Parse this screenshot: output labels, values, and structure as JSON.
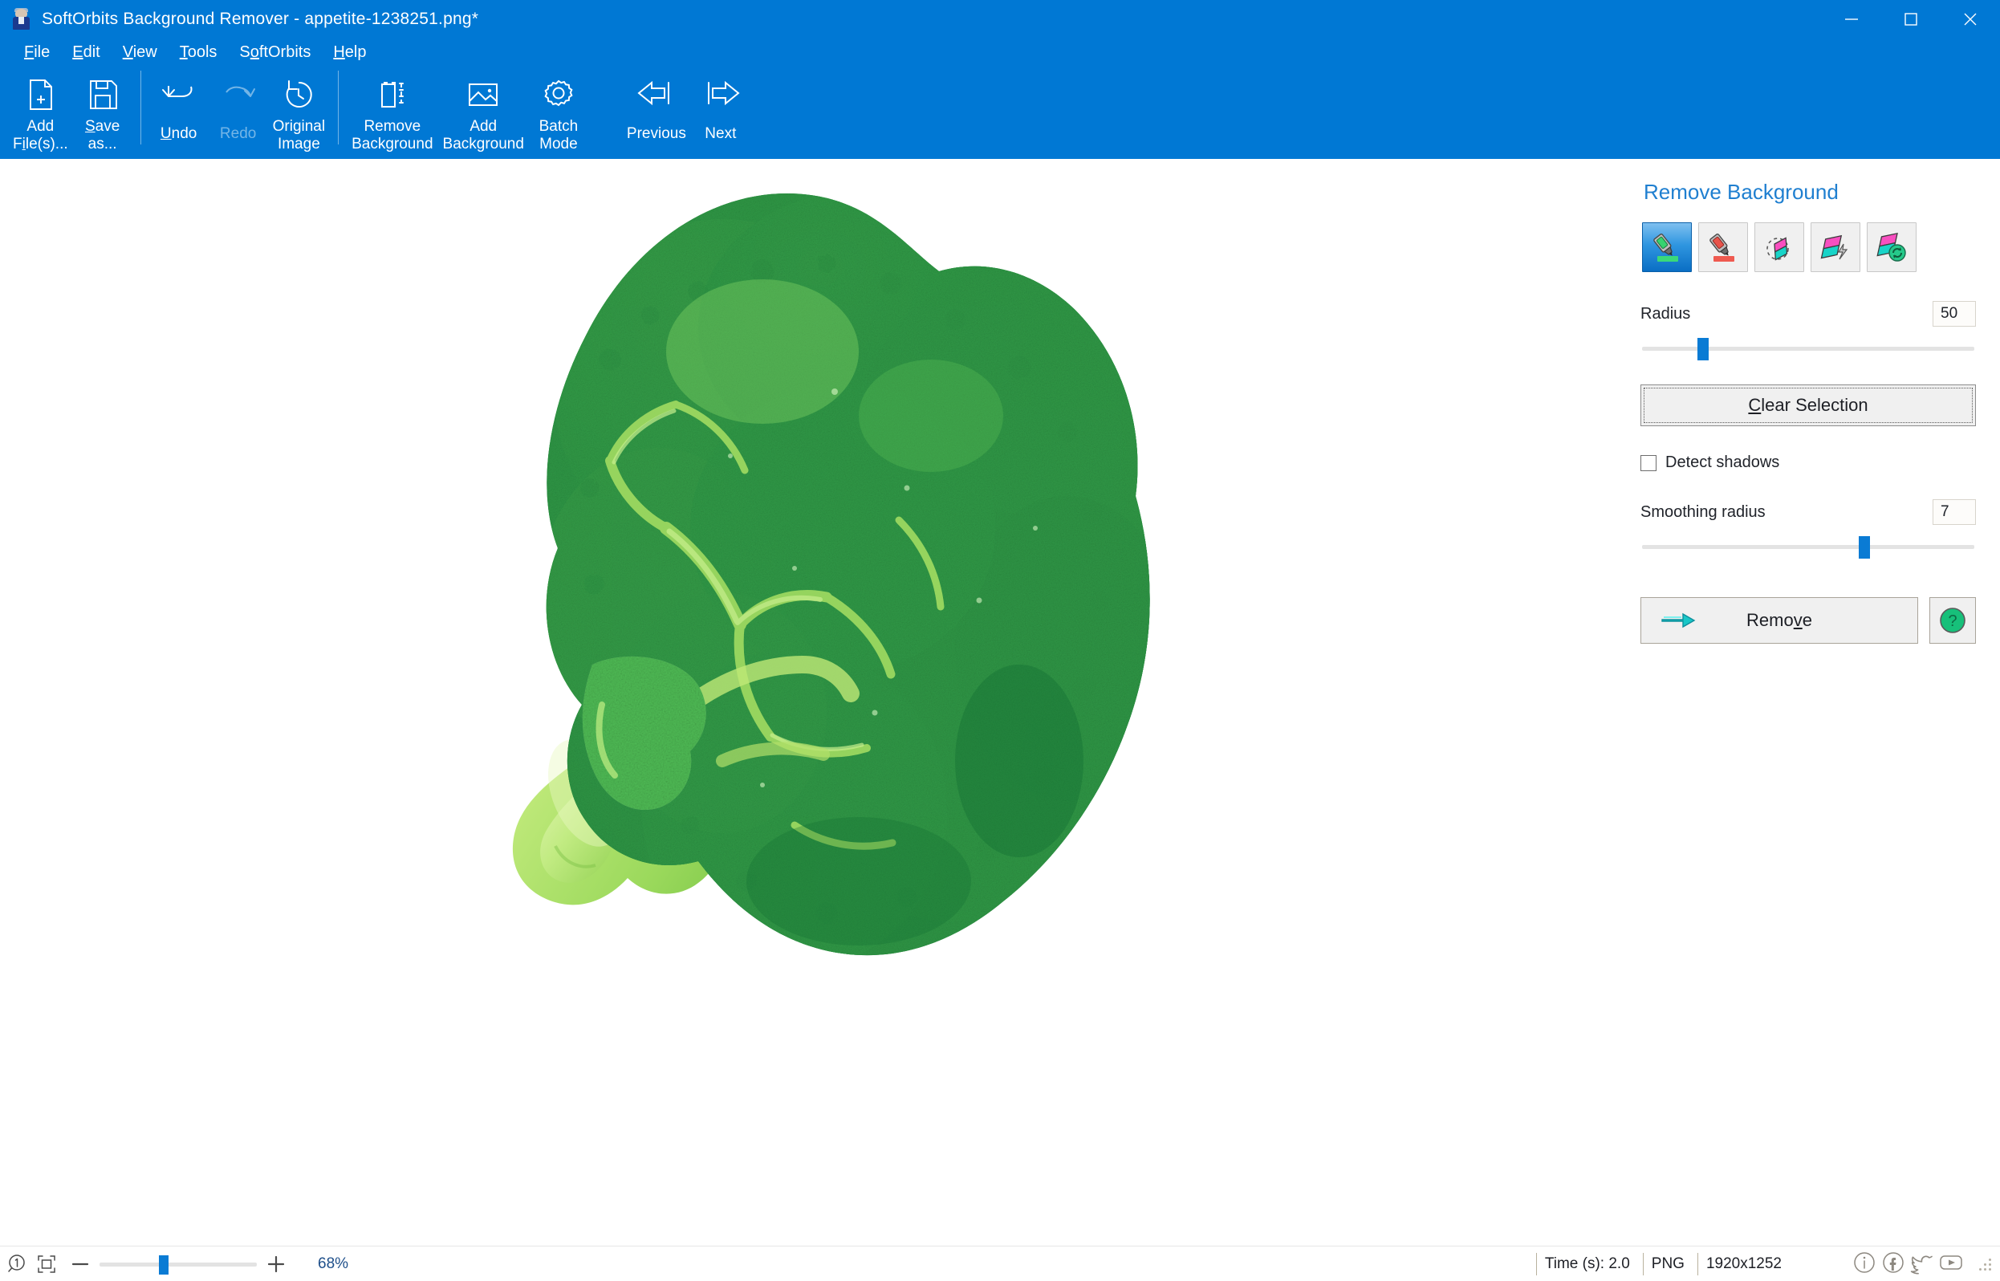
{
  "window": {
    "title": "SoftOrbits Background Remover - appetite-1238251.png*",
    "app_icon": "app-person-icon",
    "controls": {
      "minimize": "minimize-icon",
      "maximize": "maximize-icon",
      "close": "close-icon"
    }
  },
  "menubar": {
    "items": [
      {
        "label": "File",
        "mnemonic": "F"
      },
      {
        "label": "Edit",
        "mnemonic": "E"
      },
      {
        "label": "View",
        "mnemonic": "V"
      },
      {
        "label": "Tools",
        "mnemonic": "T"
      },
      {
        "label": "SoftOrbits",
        "mnemonic": "O"
      },
      {
        "label": "Help",
        "mnemonic": "H"
      }
    ]
  },
  "toolbar": {
    "add_files": "Add\nFile(s)...",
    "save_as": "Save\nas...",
    "undo": "Undo",
    "redo": "Redo",
    "original_image": "Original\nImage",
    "remove_background": "Remove\nBackground",
    "add_background": "Add\nBackground",
    "batch_mode": "Batch\nMode",
    "previous": "Previous",
    "next": "Next",
    "redo_disabled": true
  },
  "panel": {
    "title": "Remove Background",
    "tools": [
      {
        "name": "green-marker-tool",
        "selected": true
      },
      {
        "name": "red-marker-tool",
        "selected": false
      },
      {
        "name": "eraser-tool",
        "selected": false
      },
      {
        "name": "magic-wand-tool",
        "selected": false
      },
      {
        "name": "restore-selection-tool",
        "selected": false
      }
    ],
    "radius": {
      "label": "Radius",
      "value": "50",
      "slider_percent": 18
    },
    "clear_selection": "Clear Selection",
    "detect_shadows": {
      "label": "Detect shadows",
      "checked": false
    },
    "smoothing_radius": {
      "label": "Smoothing radius",
      "value": "7",
      "slider_percent": 66
    },
    "remove_button": "Remove",
    "help_button": "?"
  },
  "statusbar": {
    "zoom_actual_icon": "zoom-1-to-1-icon",
    "fit_icon": "fit-to-screen-icon",
    "zoom_out": "minus-icon",
    "zoom_in": "plus-icon",
    "zoom_percent": "68%",
    "zoom_slider_percent": 40,
    "time": "Time (s): 2.0",
    "format": "PNG",
    "dimensions": "1920x1252",
    "social": [
      "info-icon",
      "facebook-icon",
      "twitter-icon",
      "youtube-icon"
    ]
  },
  "colors": {
    "accent_blue": "#0078d4",
    "panel_title_blue": "#1f7fd0",
    "canvas_gray": "#efefef",
    "slider_blue": "#0a7bd4",
    "marker_green": "#2fc36a",
    "marker_red": "#e8534a",
    "wand_pink": "#f84fc0",
    "wand_cyan": "#18d4c8",
    "help_green": "#17c07a"
  }
}
